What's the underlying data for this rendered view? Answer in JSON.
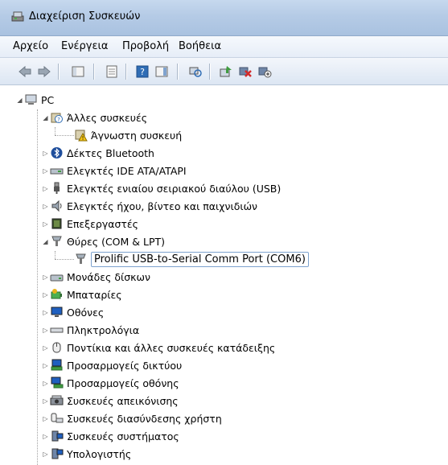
{
  "window": {
    "title": "Διαχείριση Συσκευών"
  },
  "menu": {
    "items": [
      "Αρχείο",
      "Ενέργεια",
      "Προβολή",
      "Βοήθεια"
    ]
  },
  "tree": {
    "root": "PC",
    "other_devices": {
      "label": "Άλλες συσκευές",
      "child": "Άγνωστη συσκευή"
    },
    "categories_a": [
      "Δέκτες Bluetooth",
      "Ελεγκτές IDE ATA/ATAPI",
      "Ελεγκτές ενιαίου σειριακού διαύλου (USB)",
      "Ελεγκτές ήχου, βίντεο και παιχνιδιών",
      "Επεξεργαστές"
    ],
    "ports": {
      "label": "Θύρες (COM & LPT)",
      "child": "Prolific USB-to-Serial Comm Port (COM6)"
    },
    "categories_b": [
      "Μονάδες δίσκων",
      "Μπαταρίες",
      "Οθόνες",
      "Πληκτρολόγια",
      "Ποντίκια και άλλες συσκευές κατάδειξης",
      "Προσαρμογείς δικτύου",
      "Προσαρμογείς οθόνης",
      "Συσκευές απεικόνισης",
      "Συσκευές διασύνδεσης χρήστη",
      "Συσκευές συστήματος",
      "Υπολογιστής"
    ]
  }
}
